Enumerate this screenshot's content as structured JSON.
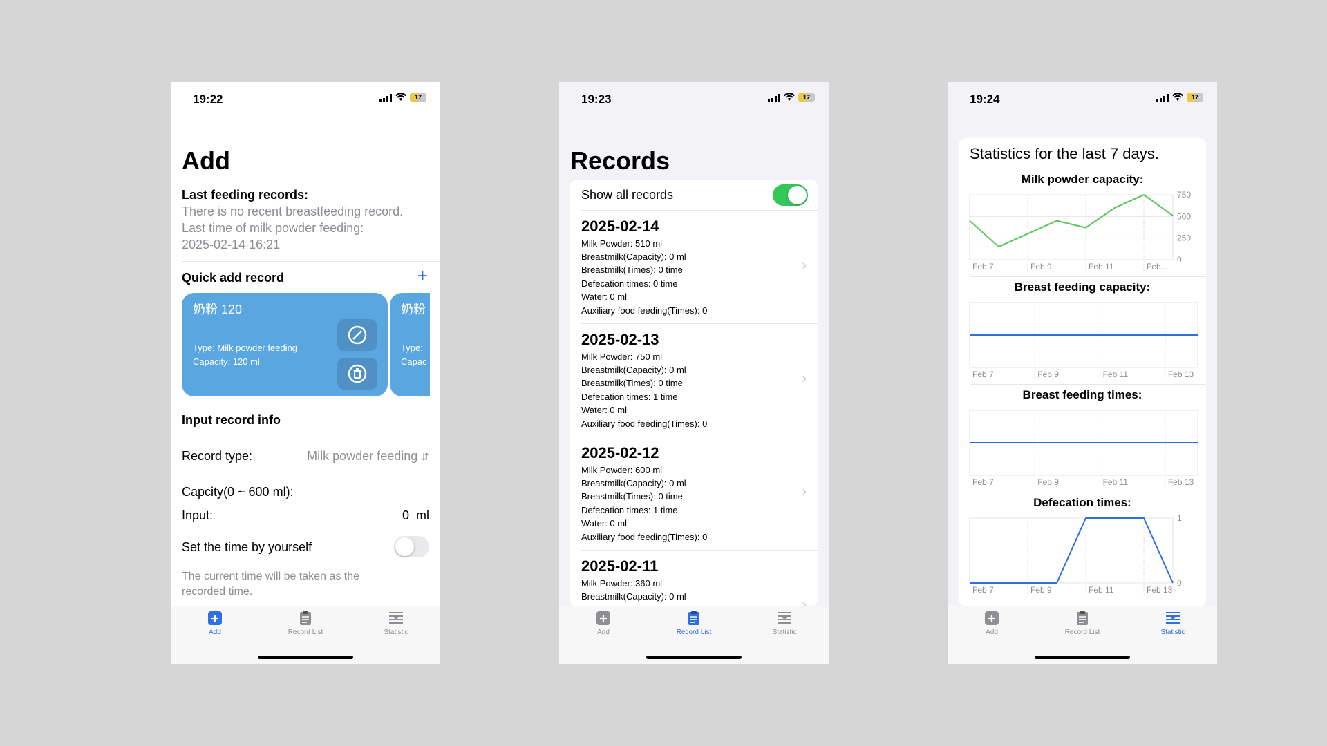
{
  "phone1": {
    "time": "19:22",
    "battery": "17",
    "title": "Add",
    "last_label": "Last feeding records:",
    "no_breast": "There is no recent breastfeeding record.",
    "last_milk_label": "Last time of milk powder feeding:",
    "last_milk_time": "2025-02-14 16:21",
    "quick_label": "Quick add record",
    "plus": "+",
    "card1": {
      "name": "奶粉 120",
      "type": "Type:  Milk powder feeding",
      "cap": "Capacity: 120 ml"
    },
    "card2": {
      "name": "奶粉",
      "type": "Type:",
      "cap": "Capac"
    },
    "input_info": "Input record info",
    "record_type_label": "Record type:",
    "record_type_value": "Milk powder feeding",
    "capacity_label": "Capcity(0 ~ 600 ml):",
    "input_label": "Input:",
    "input_value": "0",
    "input_unit": "ml",
    "set_time_label": "Set the time by yourself",
    "set_time_on": false,
    "note": "The current time will be taken as the recorded time."
  },
  "phone2": {
    "time": "19:23",
    "battery": "17",
    "title": "Records",
    "show_all": "Show all records",
    "show_all_on": true,
    "records": [
      {
        "date": "2025-02-14",
        "milk": "Milk Powder:   510   ml",
        "bcap": "Breastmilk(Capacity):   0   ml",
        "btimes": "Breastmilk(Times): 0   time",
        "defec": "Defecation times: 0   time",
        "water": "Water: 0 ml",
        "aux": "Auxiliary food feeding(Times): 0"
      },
      {
        "date": "2025-02-13",
        "milk": "Milk Powder:   750   ml",
        "bcap": "Breastmilk(Capacity):   0   ml",
        "btimes": "Breastmilk(Times): 0   time",
        "defec": "Defecation times: 1   time",
        "water": "Water: 0 ml",
        "aux": "Auxiliary food feeding(Times): 0"
      },
      {
        "date": "2025-02-12",
        "milk": "Milk Powder:   600   ml",
        "bcap": "Breastmilk(Capacity):   0   ml",
        "btimes": "Breastmilk(Times): 0   time",
        "defec": "Defecation times: 1   time",
        "water": "Water: 0 ml",
        "aux": "Auxiliary food feeding(Times): 0"
      },
      {
        "date": "2025-02-11",
        "milk": "Milk Powder:   360   ml",
        "bcap": "Breastmilk(Capacity):   0   ml",
        "btimes": "",
        "defec": "",
        "water": "",
        "aux": ""
      }
    ]
  },
  "phone3": {
    "time": "19:24",
    "battery": "17",
    "title": "Statistics for the last 7 days."
  },
  "tabs": {
    "add": "Add",
    "list": "Record List",
    "stat": "Statistic"
  },
  "colors": {
    "accent": "#2f6fde",
    "green": "#34c759",
    "line_green": "#5cc85c",
    "line_blue": "#2f6fde",
    "card": "#5aa6e0"
  },
  "chart_data": [
    {
      "type": "line",
      "title": "Milk powder capacity:",
      "x": [
        "Feb 7",
        "Feb 8",
        "Feb 9",
        "Feb 10",
        "Feb 11",
        "Feb 12",
        "Feb 13",
        "Feb 14"
      ],
      "values": [
        450,
        150,
        300,
        450,
        370,
        600,
        750,
        510
      ],
      "xticks": [
        "Feb 7",
        "Feb 9",
        "Feb 11",
        "Feb..."
      ],
      "yticks": [
        "750",
        "500",
        "250",
        "0"
      ],
      "ylim": [
        0,
        750
      ],
      "color": "#5cc85c"
    },
    {
      "type": "line",
      "title": "Breast feeding capacity:",
      "x": [
        "Feb 7",
        "Feb 8",
        "Feb 9",
        "Feb 10",
        "Feb 11",
        "Feb 12",
        "Feb 13",
        "Feb 14"
      ],
      "values": [
        0,
        0,
        0,
        0,
        0,
        0,
        0,
        0
      ],
      "xticks": [
        "Feb 7",
        "Feb 9",
        "Feb 11",
        "Feb 13"
      ],
      "color": "#2f6fde"
    },
    {
      "type": "line",
      "title": "Breast feeding times:",
      "x": [
        "Feb 7",
        "Feb 8",
        "Feb 9",
        "Feb 10",
        "Feb 11",
        "Feb 12",
        "Feb 13",
        "Feb 14"
      ],
      "values": [
        0,
        0,
        0,
        0,
        0,
        0,
        0,
        0
      ],
      "xticks": [
        "Feb 7",
        "Feb 9",
        "Feb 11",
        "Feb 13"
      ],
      "color": "#2f6fde"
    },
    {
      "type": "line",
      "title": "Defecation times:",
      "x": [
        "Feb 7",
        "Feb 8",
        "Feb 9",
        "Feb 10",
        "Feb 11",
        "Feb 12",
        "Feb 13",
        "Feb 14"
      ],
      "values": [
        0,
        0,
        0,
        0,
        1,
        1,
        1,
        0
      ],
      "xticks": [
        "Feb 7",
        "Feb 9",
        "Feb 11",
        "Feb 13"
      ],
      "yticks": [
        "1",
        "0"
      ],
      "ylim": [
        0,
        1
      ],
      "color": "#2f6fde"
    }
  ]
}
